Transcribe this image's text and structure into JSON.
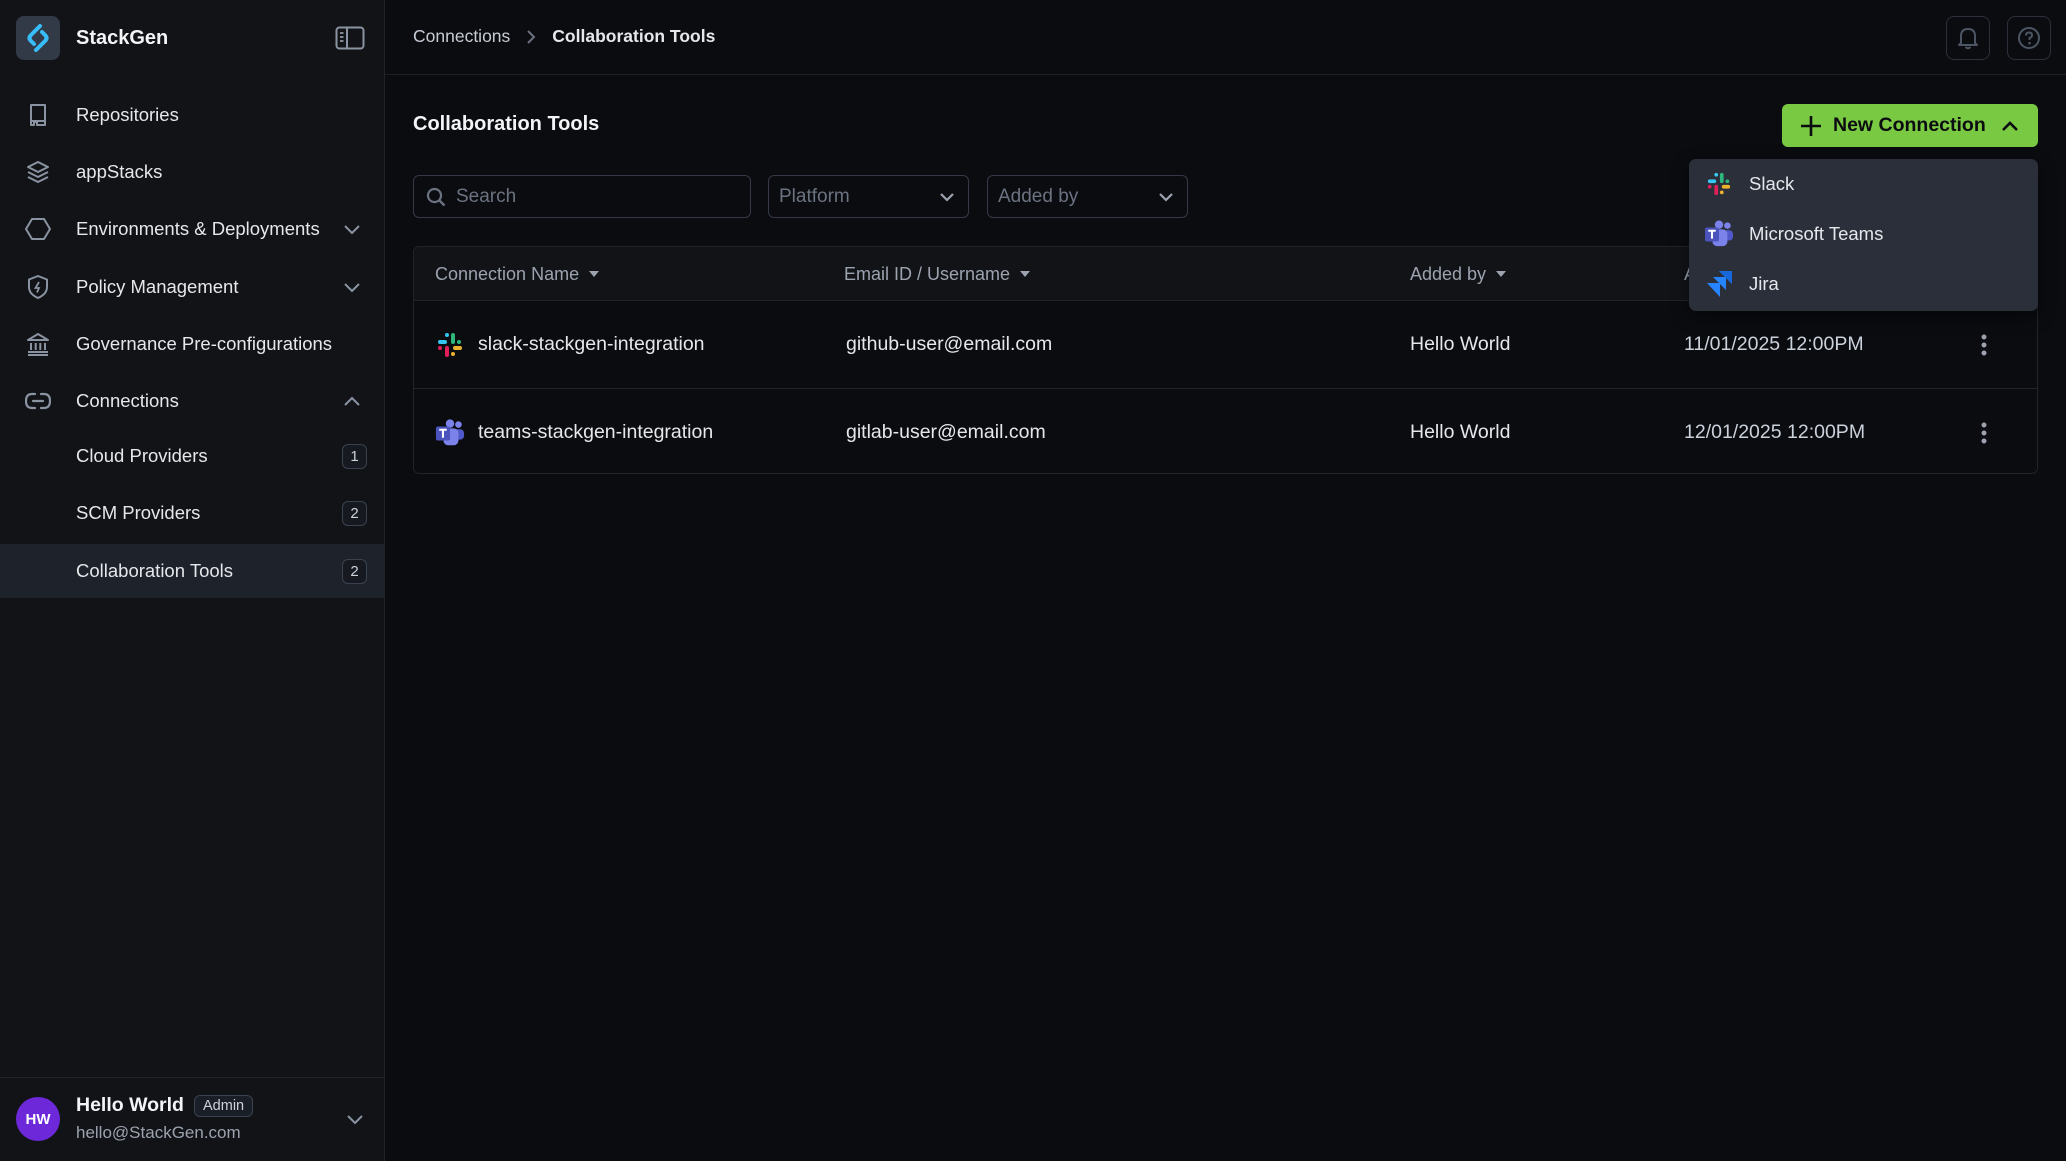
{
  "sidebar": {
    "brand": "StackGen",
    "items": [
      {
        "label": "Repositories",
        "icon": "repository-icon"
      },
      {
        "label": "appStacks",
        "icon": "layers-icon"
      },
      {
        "label": "Environments & Deployments",
        "icon": "hexagon-icon",
        "expandable": true,
        "expanded": false
      },
      {
        "label": "Policy Management",
        "icon": "shield-icon",
        "expandable": true,
        "expanded": false
      },
      {
        "label": "Governance Pre-configurations",
        "icon": "bank-icon"
      },
      {
        "label": "Connections",
        "icon": "link-icon",
        "expandable": true,
        "expanded": true
      }
    ],
    "subitems": [
      {
        "label": "Cloud Providers",
        "count": "1"
      },
      {
        "label": "SCM Providers",
        "count": "2"
      },
      {
        "label": "Collaboration Tools",
        "count": "2",
        "active": true
      }
    ],
    "user": {
      "initials": "HW",
      "name": "Hello World",
      "role": "Admin",
      "email": "hello@StackGen.com"
    }
  },
  "header": {
    "breadcrumb": [
      "Connections",
      "Collaboration Tools"
    ]
  },
  "main": {
    "title": "Collaboration Tools",
    "new_connection_label": "New Connection",
    "search_placeholder": "Search",
    "filters": {
      "platform": "Platform",
      "added_by": "Added by"
    },
    "table": {
      "columns": [
        "Connection Name",
        "Email ID / Username",
        "Added by",
        "A"
      ],
      "rows": [
        {
          "platform": "slack",
          "name": "slack-stackgen-integration",
          "email": "github-user@email.com",
          "added_by": "Hello World",
          "added_on": "11/01/2025 12:00PM"
        },
        {
          "platform": "teams",
          "name": "teams-stackgen-integration",
          "email": "gitlab-user@email.com",
          "added_by": "Hello World",
          "added_on": "12/01/2025 12:00PM"
        }
      ]
    },
    "new_connection_menu": [
      {
        "label": "Slack",
        "icon": "slack-icon"
      },
      {
        "label": "Microsoft Teams",
        "icon": "microsoft-teams-icon"
      },
      {
        "label": "Jira",
        "icon": "jira-icon"
      }
    ]
  },
  "colors": {
    "accent": "#7ac943",
    "avatar": "#6d28d9",
    "brand_icon": "#38bdf8"
  }
}
